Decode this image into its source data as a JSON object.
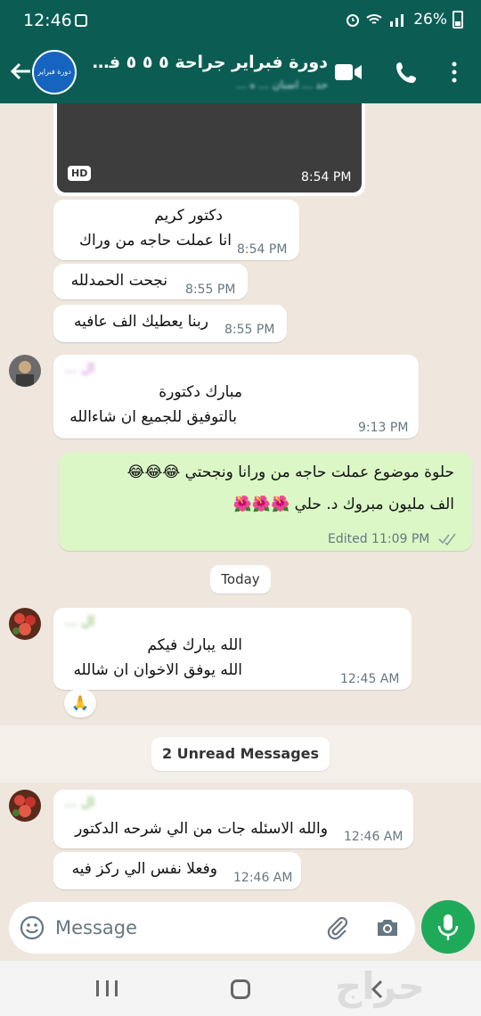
{
  "status_bar": {
    "time": "12:46",
    "battery": "26%"
  },
  "header": {
    "title": "دورة فبراير جراحة ٥ ٥ ٥ فكي...",
    "subtitle": "حد ... اسنان ... ه ...",
    "avatar_text": "دورة فبراير"
  },
  "video_message": {
    "badge": "HD",
    "time": "8:54 PM"
  },
  "messages": [
    {
      "lines": [
        "دكتور كريم",
        "انا عملت حاجه من وراك"
      ],
      "time": "8:54 PM"
    },
    {
      "lines": [
        "نجحت الحمدلله"
      ],
      "time": "8:55 PM"
    },
    {
      "lines": [
        "ربنا يعطيك الف عافيه"
      ],
      "time": "8:55 PM"
    },
    {
      "sender": "ال ...",
      "lines": [
        "مبارك دكتورة",
        "بالتوفيق للجميع ان شاءالله"
      ],
      "time": "9:13 PM"
    },
    {
      "lines": [
        "حلوة موضوع عملت حاجه من ورانا ونجحتي 😂😂😂",
        "الف مليون مبروك د. حلي 🌺🌺🌺"
      ],
      "time": "Edited 11:09 PM"
    },
    {
      "sender": "ال ...",
      "lines": [
        "الله يبارك فيكم",
        "الله يوفق الاخوان ان شالله"
      ],
      "time": "12:45 AM"
    },
    {
      "sender": "ال ...",
      "lines": [
        "والله الاسئله جات من الي شرحه الدكتور"
      ],
      "time": "12:46 AM"
    },
    {
      "lines": [
        "وفعلا نفس الي ركز فيه"
      ],
      "time": "12:46 AM"
    }
  ],
  "reaction": "🙏",
  "date_chip": "Today",
  "unread_chip": "2 Unread Messages",
  "composer": {
    "placeholder": "Message"
  },
  "watermark": "حراج",
  "colors": {
    "header": "#0b5d54",
    "outgoing": "#dbf7c6",
    "mic": "#1faa5a",
    "chat_bg": "#efe7de"
  }
}
